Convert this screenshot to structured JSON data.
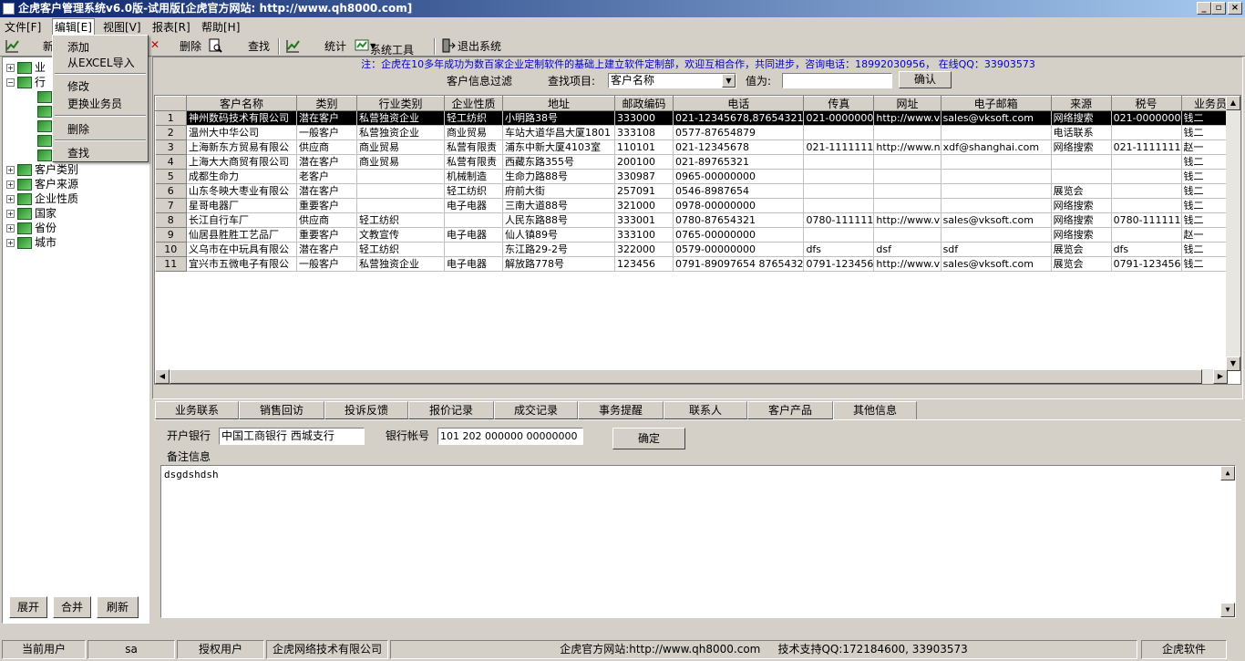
{
  "window": {
    "title": "企虎客户管理系统v6.0版-试用版[企虎官方网站: http://www.qh8000.com]"
  },
  "menu": {
    "file": "文件[F]",
    "edit": "编辑[E]",
    "view": "视图[V]",
    "report": "报表[R]",
    "help": "帮助[H]"
  },
  "toolbar": {
    "new": "新",
    "delete": "删除",
    "find": "查找",
    "stats": "统计",
    "tools": "系统工具",
    "exit": "退出系统"
  },
  "context_menu": {
    "add": "添加",
    "import_excel": "从EXCEL导入",
    "modify": "修改",
    "change_salesman": "更换业务员",
    "delete": "删除",
    "find": "查找"
  },
  "tree": {
    "items": [
      {
        "label": "业"
      },
      {
        "label": "行"
      },
      {
        "label": "客户类别"
      },
      {
        "label": "客户来源"
      },
      {
        "label": "企业性质"
      },
      {
        "label": "国家"
      },
      {
        "label": "省份"
      },
      {
        "label": "城市"
      }
    ],
    "expand": "展开",
    "merge": "合并",
    "refresh": "刷新"
  },
  "notice": "注：企虎在10多年成功为数百家企业定制软件的基础上建立软件定制部，欢迎互相合作，共同进步，咨询电话：18992030956，   在线QQ：33903573",
  "filter": {
    "title": "客户信息过滤",
    "field_label": "查找项目:",
    "field_value": "客户名称",
    "value_label": "值为:",
    "value": "",
    "confirm": "确认"
  },
  "grid": {
    "columns": [
      "",
      "客户名称",
      "类别",
      "行业类别",
      "企业性质",
      "地址",
      "邮政编码",
      "电话",
      "传真",
      "网址",
      "电子邮箱",
      "来源",
      "税号",
      "业务员"
    ],
    "rows": [
      [
        "1",
        "神州数码技术有限公司",
        "潜在客户",
        "私营独资企业",
        "轻工纺织",
        "小明路38号",
        "333000",
        "021-12345678,87654321",
        "021-0000000",
        "http://www.v",
        "sales@vksoft.com",
        "网络搜索",
        "021-0000000",
        "钱二"
      ],
      [
        "2",
        "温州大中华公司",
        "一般客户",
        "私营独资企业",
        "商业贸易",
        "车站大道华昌大厦1801",
        "333108",
        "0577-87654879",
        "",
        "",
        "",
        "电话联系",
        "",
        "钱二"
      ],
      [
        "3",
        "上海新东方贸易有限公",
        "供应商",
        "商业贸易",
        "私营有限责",
        "浦东中新大厦4103室",
        "110101",
        "021-12345678",
        "021-1111111",
        "http://www.n",
        "xdf@shanghai.com",
        "网络搜索",
        "021-1111111",
        "赵一"
      ],
      [
        "4",
        "上海大大商贸有限公司",
        "潜在客户",
        "商业贸易",
        "私营有限责",
        "西藏东路355号",
        "200100",
        "021-89765321",
        "",
        "",
        "",
        "",
        "",
        "钱二"
      ],
      [
        "5",
        "成都生命力",
        "老客户",
        "",
        "机械制造",
        "生命力路88号",
        "330987",
        "0965-00000000",
        "",
        "",
        "",
        "",
        "",
        "钱二"
      ],
      [
        "6",
        "山东冬映大枣业有限公",
        "潜在客户",
        "",
        "轻工纺织",
        "府前大街",
        "257091",
        "0546-8987654",
        "",
        "",
        "",
        "展览会",
        "",
        "钱二"
      ],
      [
        "7",
        "星哥电器厂",
        "重要客户",
        "",
        "电子电器",
        "三南大道88号",
        "321000",
        "0978-00000000",
        "",
        "",
        "",
        "网络搜索",
        "",
        "钱二"
      ],
      [
        "8",
        "长江自行车厂",
        "供应商",
        "轻工纺织",
        "",
        "人民东路88号",
        "333001",
        "0780-87654321",
        "0780-111111",
        "http://www.v",
        "sales@vksoft.com",
        "网络搜索",
        "0780-111111",
        "钱二"
      ],
      [
        "9",
        "仙居县胜胜工艺品厂",
        "重要客户",
        "文教宣传",
        "电子电器",
        "仙人镇89号",
        "333100",
        "0765-00000000",
        "",
        "",
        "",
        "网络搜索",
        "",
        "赵一"
      ],
      [
        "10",
        "义乌市在中玩具有限公",
        "潜在客户",
        "轻工纺织",
        "",
        "东江路29-2号",
        "322000",
        "0579-00000000",
        "dfs",
        "dsf",
        "sdf",
        "展览会",
        "dfs",
        "钱二"
      ],
      [
        "11",
        "宜兴市五微电子有限公",
        "一般客户",
        "私营独资企业",
        "电子电器",
        "解放路778号",
        "123456",
        "0791-89097654 8765432",
        "0791-123456",
        "http://www.v",
        "sales@vksoft.com",
        "展览会",
        "0791-123456",
        "钱二"
      ]
    ]
  },
  "tabs": [
    "业务联系",
    "销售回访",
    "投诉反馈",
    "报价记录",
    "成交记录",
    "事务提醒",
    "联系人",
    "客户产品",
    "其他信息"
  ],
  "detail": {
    "bank_label": "开户银行",
    "bank": "中国工商银行 西城支行",
    "account_label": "银行帐号",
    "account": "101 202 000000 00000000",
    "ok": "确定",
    "remark_label": "备注信息",
    "remark": "dsgdshdsh"
  },
  "status": {
    "current_user_label": "当前用户",
    "current_user": "sa",
    "licensed_label": "授权用户",
    "licensed": "企虎网络技术有限公司",
    "site": "企虎官方网站:http://www.qh8000.com",
    "support": "技术支持QQ:172184600, 33903573",
    "brand": "企虎软件"
  }
}
